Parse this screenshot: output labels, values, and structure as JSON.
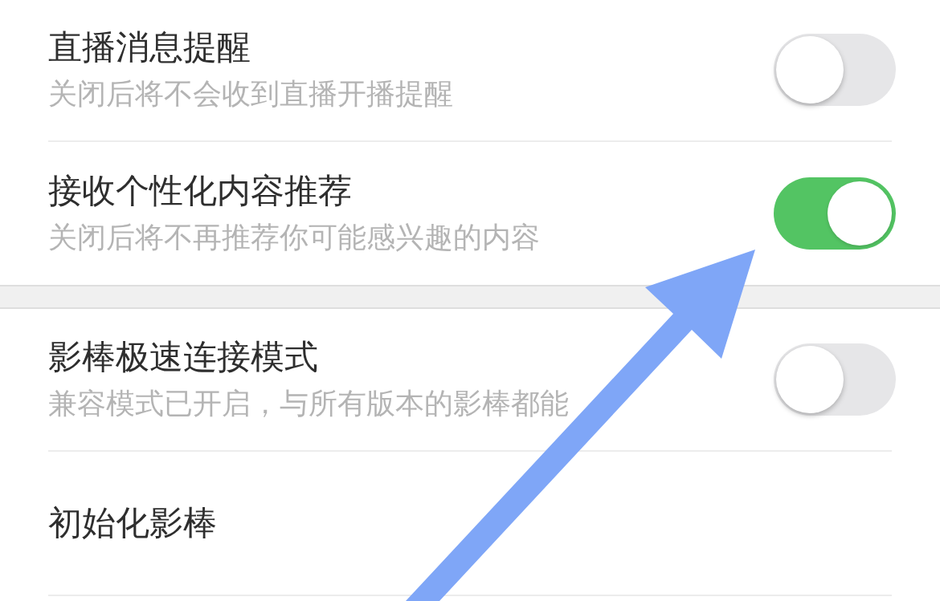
{
  "settings_groups": [
    {
      "items": [
        {
          "kind": "toggle",
          "title": "直播消息提醒",
          "subtitle": "关闭后将不会收到直播开播提醒",
          "on": false
        },
        {
          "kind": "toggle",
          "title": "接收个性化内容推荐",
          "subtitle": "关闭后将不再推荐你可能感兴趣的内容",
          "on": true
        }
      ]
    },
    {
      "items": [
        {
          "kind": "toggle",
          "title": "影棒极速连接模式",
          "subtitle": "兼容模式已开启，与所有版本的影棒都能",
          "on": false
        },
        {
          "kind": "plain",
          "title": "初始化影棒"
        }
      ]
    }
  ]
}
